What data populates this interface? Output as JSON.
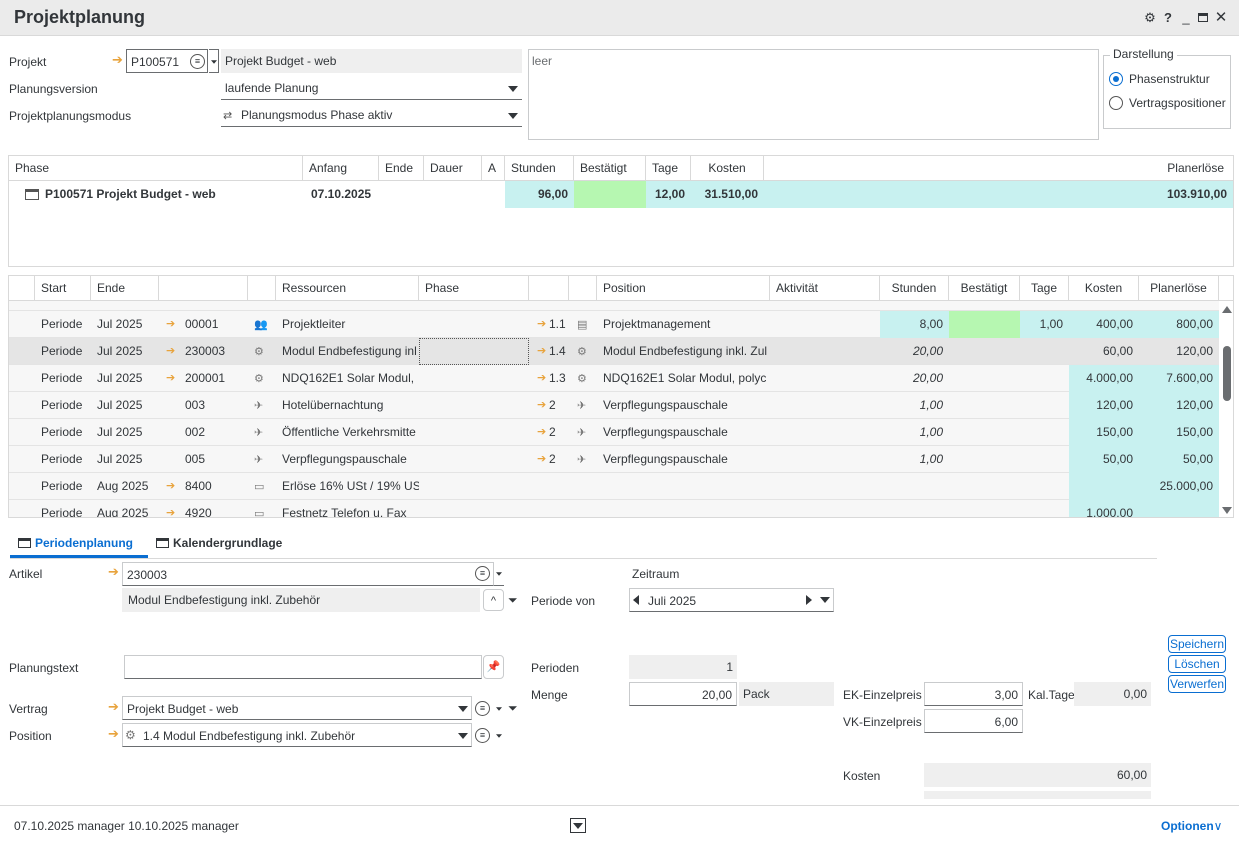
{
  "window": {
    "title": "Projektplanung",
    "icons": [
      "gear-icon",
      "help-icon",
      "minimize-icon",
      "maximize-icon",
      "close-icon"
    ]
  },
  "header": {
    "projekt_label": "Projekt",
    "projekt_value": "P100571",
    "projekt_name": "Projekt Budget - web",
    "version_label": "Planungsversion",
    "version_value": "laufende Planung",
    "modus_label": "Projektplanungsmodus",
    "modus_value": "Planungsmodus Phase aktiv",
    "notes_text": "leer",
    "darstellung_title": "Darstellung",
    "radio1": "Phasenstruktur",
    "radio2": "Vertragspositioner"
  },
  "phase_grid": {
    "headers": [
      "Phase",
      "Anfang",
      "Ende",
      "Dauer",
      "A",
      "Stunden",
      "Bestätigt",
      "Tage",
      "Kosten",
      "Planerlöse"
    ],
    "row": {
      "phase": "P100571 Projekt Budget - web",
      "anfang": "07.10.2025",
      "stunden": "96,00",
      "tage": "12,00",
      "kosten": "31.510,00",
      "planerloese": "103.910,00"
    }
  },
  "detail_grid": {
    "headers": [
      "Start",
      "Ende",
      "Ressourcen",
      "Phase",
      "Position",
      "Aktivität",
      "Stunden",
      "Bestätigt",
      "Tage",
      "Kosten",
      "Planerlöse"
    ],
    "rows": [
      {
        "start": "Periode",
        "ende": "Jul 2025",
        "nr": "00001",
        "res": "Projektleiter",
        "phase": "1.1",
        "pos": "Projektmanagement",
        "stunden": "8,00",
        "tage": "1,00",
        "kosten": "400,00",
        "erloese": "800,00"
      },
      {
        "start": "Periode",
        "ende": "Jul 2025",
        "nr": "230003",
        "res": "Modul Endbefestigung inl",
        "phase": "1.4",
        "pos": "Modul Endbefestigung inkl. Zul",
        "stunden": "20,00",
        "tage": "",
        "kosten": "60,00",
        "erloese": "120,00"
      },
      {
        "start": "Periode",
        "ende": "Jul 2025",
        "nr": "200001",
        "res": "NDQ162E1 Solar Modul,",
        "phase": "1.3",
        "pos": "NDQ162E1 Solar Modul, polyc",
        "stunden": "20,00",
        "tage": "",
        "kosten": "4.000,00",
        "erloese": "7.600,00"
      },
      {
        "start": "Periode",
        "ende": "Jul 2025",
        "nr": "003",
        "res": "Hotelübernachtung",
        "phase": "2",
        "pos": "Verpflegungspauschale",
        "stunden": "1,00",
        "tage": "",
        "kosten": "120,00",
        "erloese": "120,00"
      },
      {
        "start": "Periode",
        "ende": "Jul 2025",
        "nr": "002",
        "res": "Öffentliche Verkehrsmitte",
        "phase": "2",
        "pos": "Verpflegungspauschale",
        "stunden": "1,00",
        "tage": "",
        "kosten": "150,00",
        "erloese": "150,00"
      },
      {
        "start": "Periode",
        "ende": "Jul 2025",
        "nr": "005",
        "res": "Verpflegungspauschale",
        "phase": "2",
        "pos": "Verpflegungspauschale",
        "stunden": "1,00",
        "tage": "",
        "kosten": "50,00",
        "erloese": "50,00"
      },
      {
        "start": "Periode",
        "ende": "Aug 2025",
        "nr": "8400",
        "res": "Erlöse 16% USt / 19% US",
        "phase": "",
        "pos": "",
        "stunden": "",
        "tage": "",
        "kosten": "",
        "erloese": "25.000,00"
      },
      {
        "start": "Periode",
        "ende": "Aug 2025",
        "nr": "4920",
        "res": "Festnetz Telefon u. Fax",
        "phase": "",
        "pos": "",
        "stunden": "",
        "tage": "",
        "kosten": "1.000,00",
        "erloese": ""
      }
    ]
  },
  "tabs": {
    "t1": "Periodenplanung",
    "t2": "Kalendergrundlage"
  },
  "form": {
    "artikel_label": "Artikel",
    "artikel_value": "230003",
    "artikel_desc": "Modul Endbefestigung inkl. Zubehör",
    "zeitraum_label": "Zeitraum",
    "periode_von_label": "Periode von",
    "periode_von_value": "Juli 2025",
    "planungstext_label": "Planungstext",
    "perioden_label": "Perioden",
    "perioden_value": "1",
    "menge_label": "Menge",
    "menge_value": "20,00",
    "menge_unit": "Pack",
    "ek_label": "EK-Einzelpreis",
    "ek_value": "3,00",
    "kaltage_label": "Kal.Tage",
    "kaltage_value": "0,00",
    "vk_label": "VK-Einzelpreis",
    "vk_value": "6,00",
    "vertrag_label": "Vertrag",
    "vertrag_value": "Projekt Budget - web",
    "position_label": "Position",
    "position_value": "1.4 Modul Endbefestigung inkl. Zubehör",
    "kosten_label": "Kosten",
    "kosten_value": "60,00",
    "btn_save": "Speichern",
    "btn_delete": "Löschen",
    "btn_discard": "Verwerfen"
  },
  "footer": {
    "status": "07.10.2025 manager 10.10.2025 manager",
    "options": "Optionen"
  }
}
